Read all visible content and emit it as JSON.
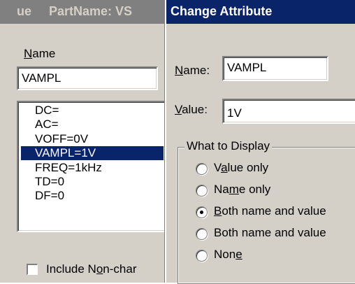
{
  "part_window": {
    "title_prefix": "ue",
    "title": "PartName: VS",
    "name_label": "Name",
    "name_value": "VAMPL",
    "attributes": [
      {
        "text": "DC=",
        "selected": false
      },
      {
        "text": "AC=",
        "selected": false
      },
      {
        "text": "VOFF=0V",
        "selected": false
      },
      {
        "text": "VAMPL=1V",
        "selected": true
      },
      {
        "text": "FREQ=1kHz",
        "selected": false
      },
      {
        "text": "TD=0",
        "selected": false
      },
      {
        "text": "DF=0",
        "selected": false
      }
    ],
    "include_label": "Include Non-char"
  },
  "dialog": {
    "title": "Change Attribute",
    "name_label": "Name:",
    "name_value": "VAMPL",
    "value_label": "Value:",
    "value_value": "1V",
    "display_group_label": "What to Display",
    "options": [
      {
        "label": "Value only",
        "selected": false
      },
      {
        "label": "Name only",
        "selected": false
      },
      {
        "label": "Both name and value",
        "selected": true
      },
      {
        "label": "Both name and value",
        "selected": false
      },
      {
        "label": "None",
        "selected": false
      }
    ]
  },
  "colors": {
    "active_title": "#0a246a",
    "inactive_title": "#808080",
    "face": "#d4d0c8",
    "selection": "#0a246a"
  }
}
